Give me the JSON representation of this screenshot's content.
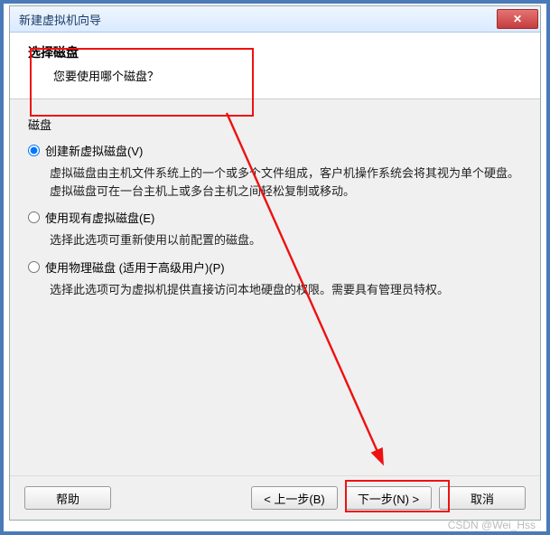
{
  "window": {
    "title": "新建虚拟机向导"
  },
  "header": {
    "title": "选择磁盘",
    "subtitle": "您要使用哪个磁盘？"
  },
  "section": {
    "label": "磁盘"
  },
  "options": {
    "create": {
      "label": "创建新虚拟磁盘(V)",
      "desc": "虚拟磁盘由主机文件系统上的一个或多个文件组成，客户机操作系统会将其视为单个硬盘。虚拟磁盘可在一台主机上或多台主机之间轻松复制或移动。"
    },
    "existing": {
      "label": "使用现有虚拟磁盘(E)",
      "desc": "选择此选项可重新使用以前配置的磁盘。"
    },
    "physical": {
      "label": "使用物理磁盘 (适用于高级用户)(P)",
      "desc": "选择此选项可为虚拟机提供直接访问本地硬盘的权限。需要具有管理员特权。"
    }
  },
  "buttons": {
    "help": "帮助",
    "back": "< 上一步(B)",
    "next": "下一步(N) >",
    "cancel": "取消"
  },
  "watermark": "CSDN @Wei_Hss",
  "annotation": {
    "color": "#e11"
  }
}
